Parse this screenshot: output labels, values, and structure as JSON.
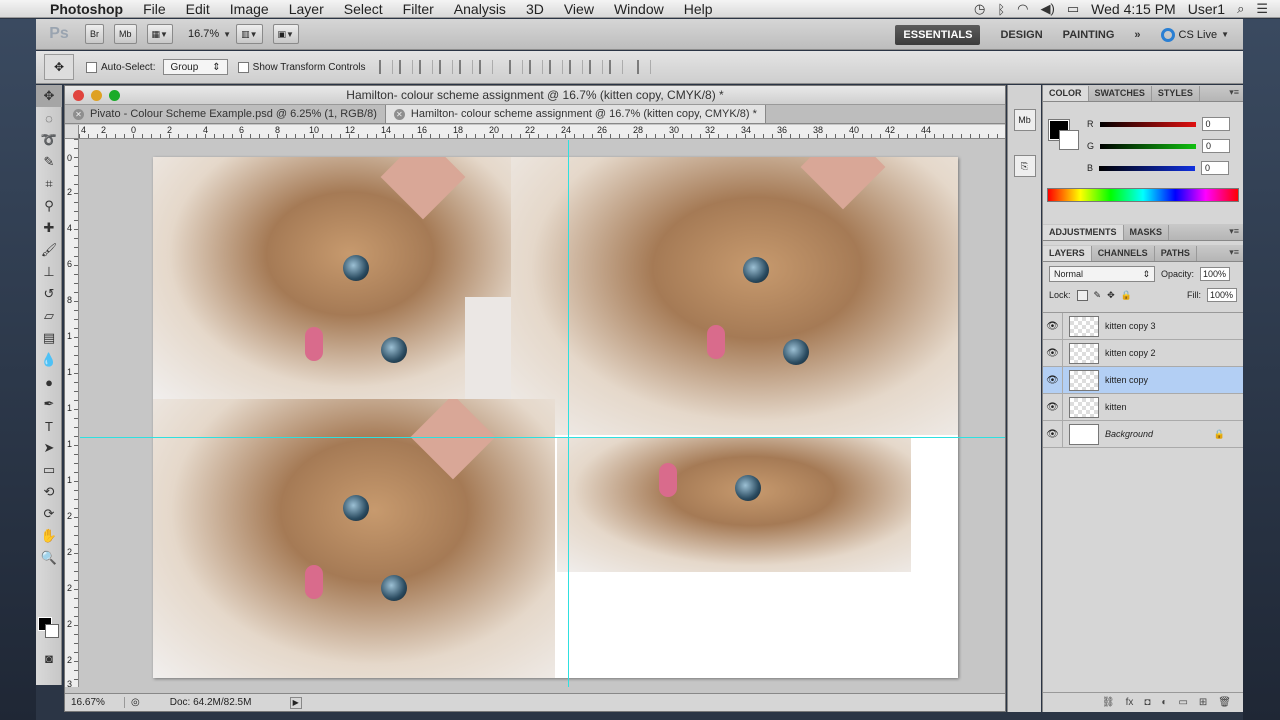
{
  "menubar": {
    "app": "Photoshop",
    "items": [
      "File",
      "Edit",
      "Image",
      "Layer",
      "Select",
      "Filter",
      "Analysis",
      "3D",
      "View",
      "Window",
      "Help"
    ],
    "clock": "Wed 4:15 PM",
    "user": "User1"
  },
  "appbar": {
    "logo": "Ps",
    "bridge": "Br",
    "minibridge": "Mb",
    "zoom": "16.7%",
    "workspaces": [
      "ESSENTIALS",
      "DESIGN",
      "PAINTING"
    ],
    "more": "»",
    "cslive": "CS Live"
  },
  "options": {
    "auto_select_label": "Auto-Select:",
    "auto_select_value": "Group",
    "show_transform_label": "Show Transform Controls"
  },
  "document": {
    "title": "Hamilton- colour scheme assignment @ 16.7% (kitten copy, CMYK/8) *",
    "tabs": [
      {
        "label": "Pivato - Colour Scheme Example.psd @ 6.25% (1, RGB/8)"
      },
      {
        "label": "Hamilton- colour scheme assignment @ 16.7% (kitten copy, CMYK/8) *"
      }
    ],
    "ruler_top": [
      "4",
      "2",
      "0",
      "2",
      "4",
      "6",
      "8",
      "10",
      "12",
      "14",
      "16",
      "18",
      "20",
      "22",
      "24",
      "26",
      "28",
      "30",
      "32",
      "34",
      "36",
      "38",
      "40",
      "42",
      "44"
    ],
    "ruler_left": [
      "0",
      "2",
      "4",
      "6",
      "8",
      "1",
      "1",
      "1",
      "1",
      "1",
      "2",
      "2",
      "2",
      "2",
      "2",
      "3"
    ],
    "status_zoom": "16.67%",
    "status_doc": "Doc: 64.2M/82.5M"
  },
  "color_panel": {
    "tabs": [
      "COLOR",
      "SWATCHES",
      "STYLES"
    ],
    "channels": [
      {
        "label": "R",
        "value": "0",
        "color": "#e01010"
      },
      {
        "label": "G",
        "value": "0",
        "color": "#10c010"
      },
      {
        "label": "B",
        "value": "0",
        "color": "#1030e0"
      }
    ]
  },
  "adjustments_panel": {
    "tabs": [
      "ADJUSTMENTS",
      "MASKS"
    ]
  },
  "layers_panel": {
    "tabs": [
      "LAYERS",
      "CHANNELS",
      "PATHS"
    ],
    "blend_mode": "Normal",
    "opacity_label": "Opacity:",
    "opacity": "100%",
    "lock_label": "Lock:",
    "fill_label": "Fill:",
    "fill": "100%",
    "layers": [
      {
        "name": "kitten copy 3"
      },
      {
        "name": "kitten copy 2"
      },
      {
        "name": "kitten copy"
      },
      {
        "name": "kitten"
      },
      {
        "name": "Background"
      }
    ]
  }
}
